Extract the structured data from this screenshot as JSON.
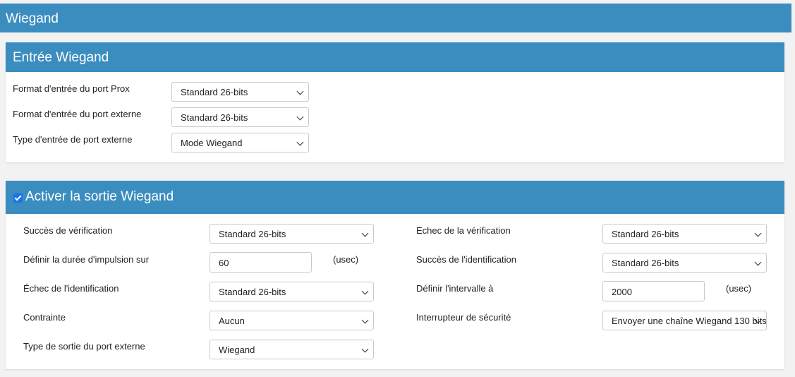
{
  "page": {
    "title": "Wiegand"
  },
  "input_panel": {
    "title": "Entrée Wiegand",
    "rows": [
      {
        "label": "Format d'entrée du port Prox",
        "value": "Standard 26-bits"
      },
      {
        "label": "Format d'entrée du port externe",
        "value": "Standard 26-bits"
      },
      {
        "label": "Type d'entrée de port externe",
        "value": "Mode Wiegand"
      }
    ]
  },
  "output_panel": {
    "title": "Activer la sortie Wiegand",
    "enabled": true,
    "left": [
      {
        "label": "Succès de vérification",
        "value": "Standard 26-bits"
      },
      {
        "label": "Définir la durée d'impulsion sur",
        "value": "60",
        "unit": "(usec)"
      },
      {
        "label": "Échec de l'identification",
        "value": "Standard 26-bits"
      },
      {
        "label": "Contrainte",
        "value": "Aucun"
      },
      {
        "label": "Type de sortie du port externe",
        "value": "Wiegand"
      }
    ],
    "right": [
      {
        "label": "Echec de la vérification",
        "value": "Standard 26-bits"
      },
      {
        "label": "Succès de l'identification",
        "value": "Standard 26-bits"
      },
      {
        "label": "Définir l'intervalle à",
        "value": "2000",
        "unit": "(usec)"
      },
      {
        "label": "Interrupteur de sécurité",
        "value": "Envoyer une chaîne Wiegand 130 bits"
      }
    ]
  },
  "colors": {
    "header": "#3b8dc0",
    "checkbox": "#1a73e8"
  }
}
